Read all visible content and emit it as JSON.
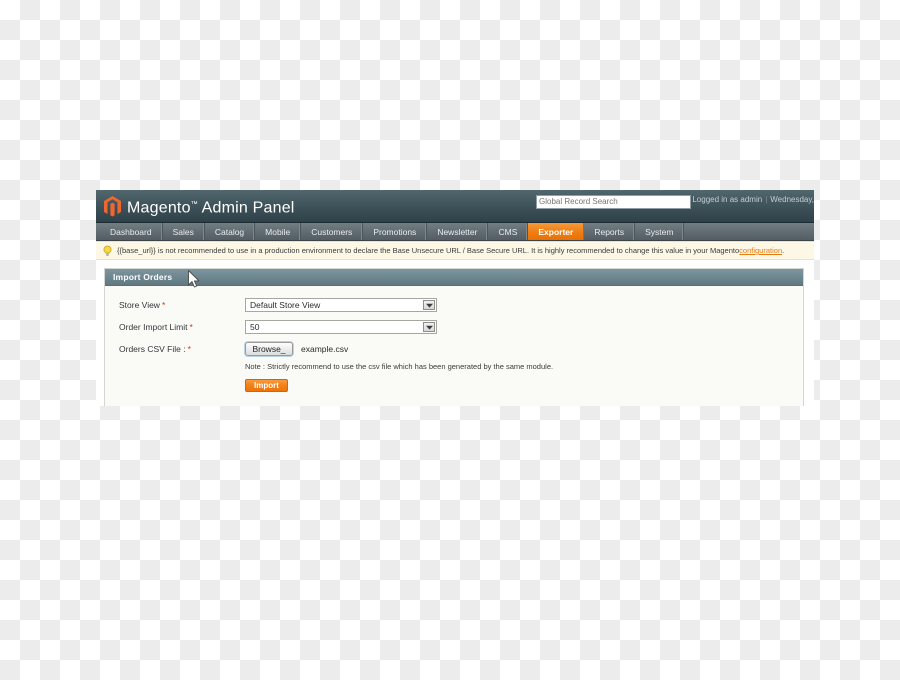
{
  "header": {
    "logo_name": "magento-logo-icon",
    "brand": "Magento",
    "trademark": "™",
    "panel_word": "Admin Panel",
    "search_placeholder": "Global Record Search",
    "search_value": "",
    "logged_in_text": "Logged in as admin",
    "separator": "|",
    "date_text": "Wednesday,"
  },
  "nav": {
    "items": [
      {
        "label": "Dashboard",
        "active": false
      },
      {
        "label": "Sales",
        "active": false
      },
      {
        "label": "Catalog",
        "active": false
      },
      {
        "label": "Mobile",
        "active": false
      },
      {
        "label": "Customers",
        "active": false
      },
      {
        "label": "Promotions",
        "active": false
      },
      {
        "label": "Newsletter",
        "active": false
      },
      {
        "label": "CMS",
        "active": false
      },
      {
        "label": "Exporter",
        "active": true
      },
      {
        "label": "Reports",
        "active": false
      },
      {
        "label": "System",
        "active": false
      }
    ]
  },
  "notice": {
    "icon": "lightbulb-icon",
    "text": "{{base_url}} is not recommended to use in a production environment to declare the Base Unsecure URL / Base Secure URL. It is highly recommended to change this value in your Magento ",
    "link_text": "configuration",
    "text_after": "."
  },
  "panel": {
    "title": "Import Orders",
    "fields": {
      "store_view": {
        "label": "Store View",
        "required_marker": "*",
        "value": "Default Store View"
      },
      "order_import_limit": {
        "label": "Order Import Limit",
        "required_marker": "*",
        "value": "50"
      },
      "orders_csv_file": {
        "label": "Orders CSV File :",
        "required_marker": "*",
        "browse_label": "Browse_",
        "filename": "example.csv",
        "note": "Note : Strictly recommend to use the csv file which has been generated by the same module."
      }
    },
    "submit_label": "Import"
  },
  "colors": {
    "accent_orange": "#ee7508",
    "header_dark": "#2f4048",
    "nav_grey": "#626c73",
    "panel_head": "#6c868f",
    "notice_bg": "#fdf7e6",
    "required_red": "#d9300d"
  }
}
